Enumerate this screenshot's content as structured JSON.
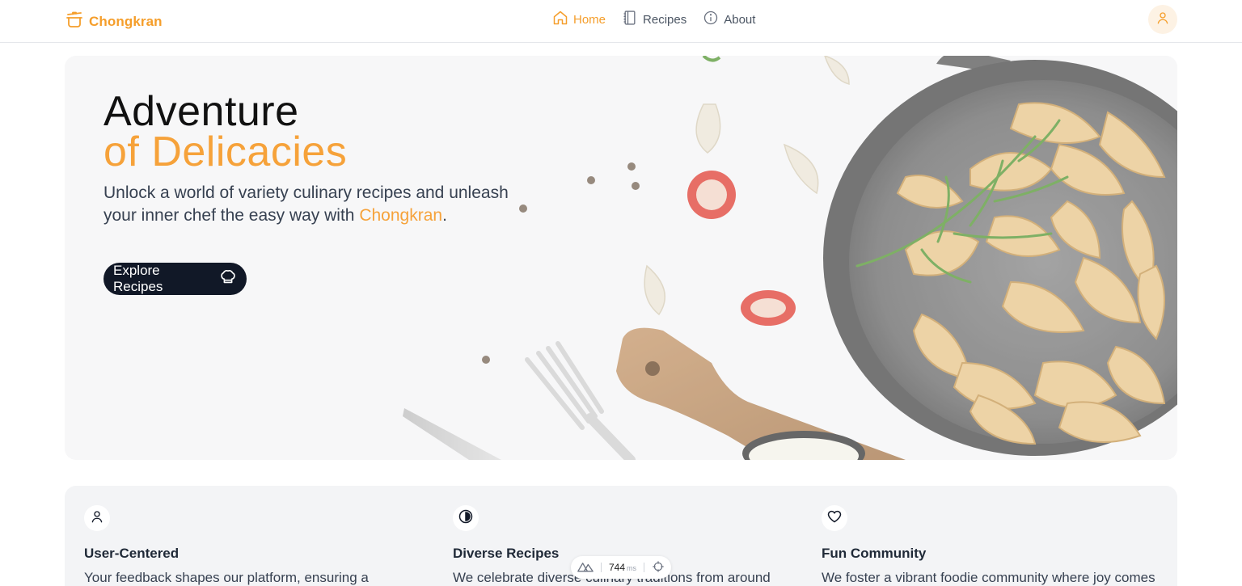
{
  "header": {
    "brand": "Chongkran",
    "nav": [
      {
        "label": "Home",
        "icon": "home-icon",
        "active": true
      },
      {
        "label": "Recipes",
        "icon": "book-icon",
        "active": false
      },
      {
        "label": "About",
        "icon": "info-icon",
        "active": false
      }
    ],
    "user_icon": "user-icon"
  },
  "hero": {
    "title_line1": "Adventure",
    "title_line2": "of Delicacies",
    "subtitle_prefix": "Unlock a world of variety culinary recipes and unleash your inner chef the easy way with ",
    "subtitle_brand": "Chongkran",
    "subtitle_suffix": ".",
    "cta_label": "Explore Recipes",
    "cta_icon": "chef-hat-icon"
  },
  "features": [
    {
      "icon": "user-icon",
      "title": "User-Centered",
      "text": "Your feedback shapes our platform, ensuring a"
    },
    {
      "icon": "contrast-icon",
      "title": "Diverse Recipes",
      "text": "We celebrate diverse culinary traditions from around"
    },
    {
      "icon": "heart-icon",
      "title": "Fun Community",
      "text": "We foster a vibrant foodie community where joy comes"
    }
  ],
  "dev_indicator": {
    "value": "744",
    "unit": "ms"
  },
  "colors": {
    "accent": "#f59e2b",
    "dark": "#111827",
    "hero_bg": "#f5f5f6"
  }
}
